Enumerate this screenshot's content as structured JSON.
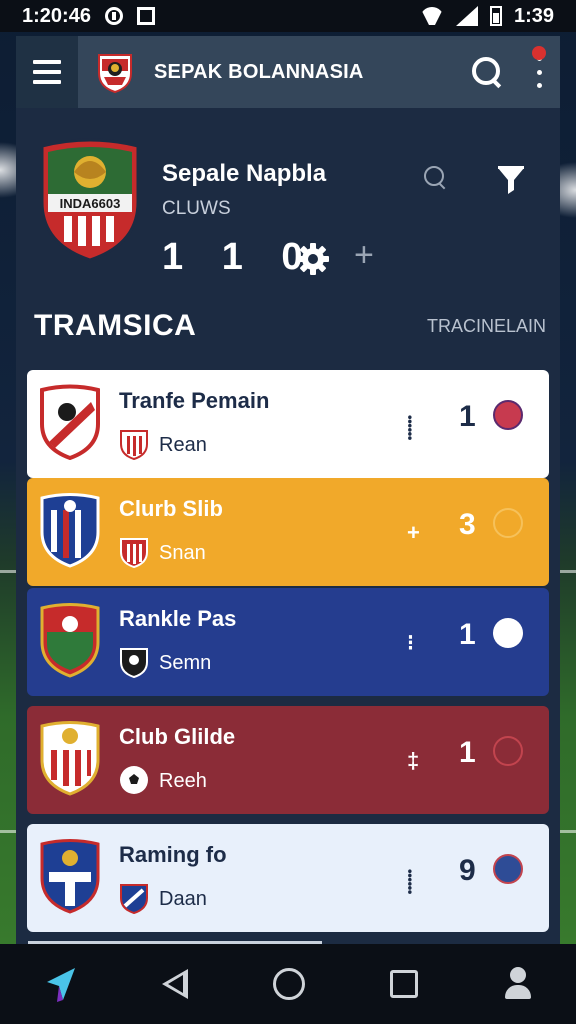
{
  "status_bar": {
    "time_left": "1:20:46",
    "time_right": "1:39"
  },
  "app_bar": {
    "title": "SEPAK BOLANNASIA"
  },
  "club": {
    "crest_text": "INDA6603",
    "name": "Sepale Napbla",
    "subtitle": "CLUWS",
    "score": "1 1 0"
  },
  "section": {
    "title": "TRAMSICA",
    "link": "TRACINELAIN"
  },
  "items": [
    {
      "title": "Tranfe Pemain",
      "subtitle": "Rean",
      "count": "1",
      "badge_color": "#c73a4f",
      "background": "#ffffff",
      "crest_colors": [
        "#c62b2b",
        "#ffffff"
      ]
    },
    {
      "title": "Clurb Slib",
      "subtitle": "Snan",
      "count": "3",
      "badge_color": "#f6c15a",
      "background": "#f1a92a",
      "crest_colors": [
        "#1e3f94",
        "#ffffff"
      ]
    },
    {
      "title": "Rankle Pas",
      "subtitle": "Semn",
      "count": "1",
      "badge_color": "#ffffff",
      "background": "#253d8f",
      "crest_colors": [
        "#c62b2b",
        "#2f7a3a"
      ]
    },
    {
      "title": "Club Glilde",
      "subtitle": "Reeh",
      "count": "1",
      "badge_color": "#c2444e",
      "background": "#8b2c37",
      "crest_colors": [
        "#c62b2b",
        "#ffffff"
      ]
    },
    {
      "title": "Raming fo",
      "subtitle": "Daan",
      "count": "9",
      "badge_color": "#2e4c96",
      "background": "#e8f0fb",
      "crest_colors": [
        "#1e3f94",
        "#c62b2b"
      ]
    }
  ]
}
